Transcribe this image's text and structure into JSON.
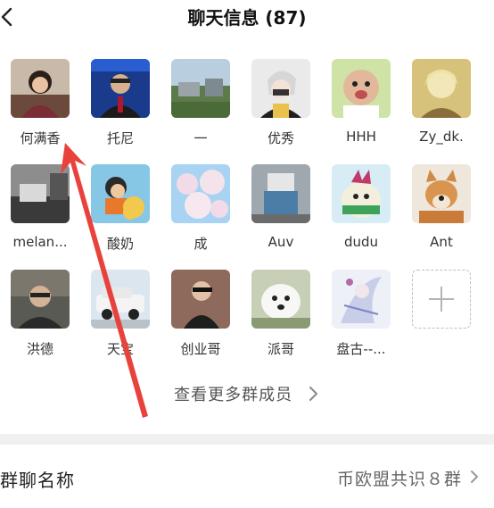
{
  "header": {
    "title": "聊天信息 (87)",
    "back_icon": "back-chevron-icon"
  },
  "members": [
    {
      "name": "何满香"
    },
    {
      "name": "托尼"
    },
    {
      "name": "一"
    },
    {
      "name": "优秀"
    },
    {
      "name": "HHH"
    },
    {
      "name": "Zy_dk."
    },
    {
      "name": "melan..."
    },
    {
      "name": "酸奶"
    },
    {
      "name": "成"
    },
    {
      "name": "Auv"
    },
    {
      "name": "dudu"
    },
    {
      "name": "Ant"
    },
    {
      "name": "洪德"
    },
    {
      "name": "天宝"
    },
    {
      "name": "创业哥"
    },
    {
      "name": "派哥"
    },
    {
      "name": "盘古--..."
    }
  ],
  "add_member_icon": "plus-icon",
  "more_members_label": "查看更多群成员",
  "group_name_row": {
    "label": "群聊名称",
    "value": "币欧盟共识８群"
  },
  "annotation_color": "#e8423c"
}
